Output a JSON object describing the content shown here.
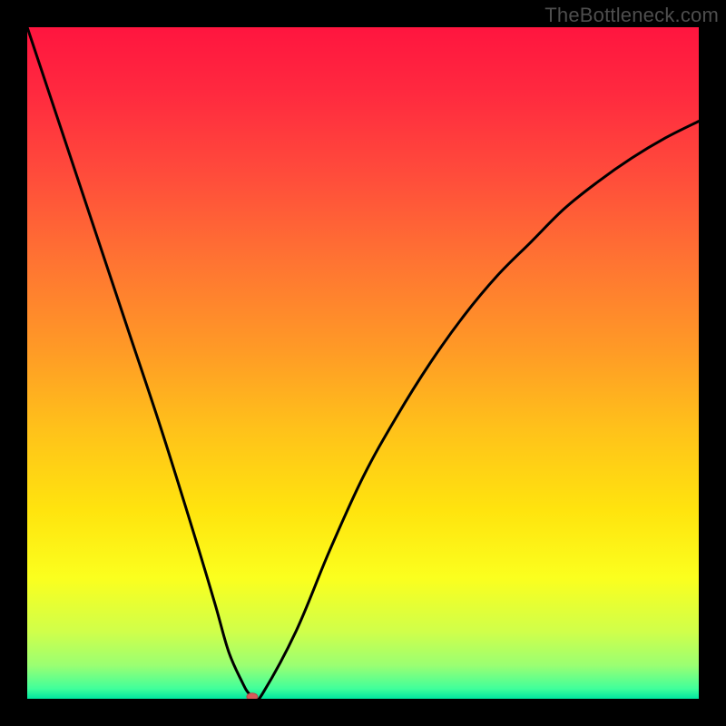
{
  "watermark": "TheBottleneck.com",
  "colors": {
    "gradient_stops": [
      {
        "offset": 0.0,
        "color": "#ff153f"
      },
      {
        "offset": 0.1,
        "color": "#ff2a3f"
      },
      {
        "offset": 0.22,
        "color": "#ff4c3b"
      },
      {
        "offset": 0.35,
        "color": "#ff7432"
      },
      {
        "offset": 0.48,
        "color": "#ff9a26"
      },
      {
        "offset": 0.6,
        "color": "#ffc21a"
      },
      {
        "offset": 0.72,
        "color": "#ffe40e"
      },
      {
        "offset": 0.82,
        "color": "#fbff1e"
      },
      {
        "offset": 0.9,
        "color": "#d0ff4a"
      },
      {
        "offset": 0.95,
        "color": "#9bff72"
      },
      {
        "offset": 0.985,
        "color": "#40ff9b"
      },
      {
        "offset": 1.0,
        "color": "#00e6a0"
      }
    ],
    "curve": "#000000",
    "marker": "#d65a5a",
    "frame": "#000000"
  },
  "chart_data": {
    "type": "line",
    "title": "",
    "xlabel": "",
    "ylabel": "",
    "xlim": [
      0,
      100
    ],
    "ylim": [
      0,
      100
    ],
    "series": [
      {
        "name": "bottleneck-curve",
        "x": [
          0,
          5,
          10,
          15,
          20,
          25,
          28,
          30,
          32,
          33,
          34,
          35,
          40,
          45,
          50,
          55,
          60,
          65,
          70,
          75,
          80,
          85,
          90,
          95,
          100
        ],
        "values": [
          100,
          85,
          70,
          55,
          40,
          24,
          14,
          7,
          2.5,
          0.8,
          0.2,
          0.7,
          10,
          22,
          33,
          42,
          50,
          57,
          63,
          68,
          73,
          77,
          80.5,
          83.5,
          86
        ]
      }
    ],
    "marker": {
      "x": 33.5,
      "y": 0.3
    }
  }
}
